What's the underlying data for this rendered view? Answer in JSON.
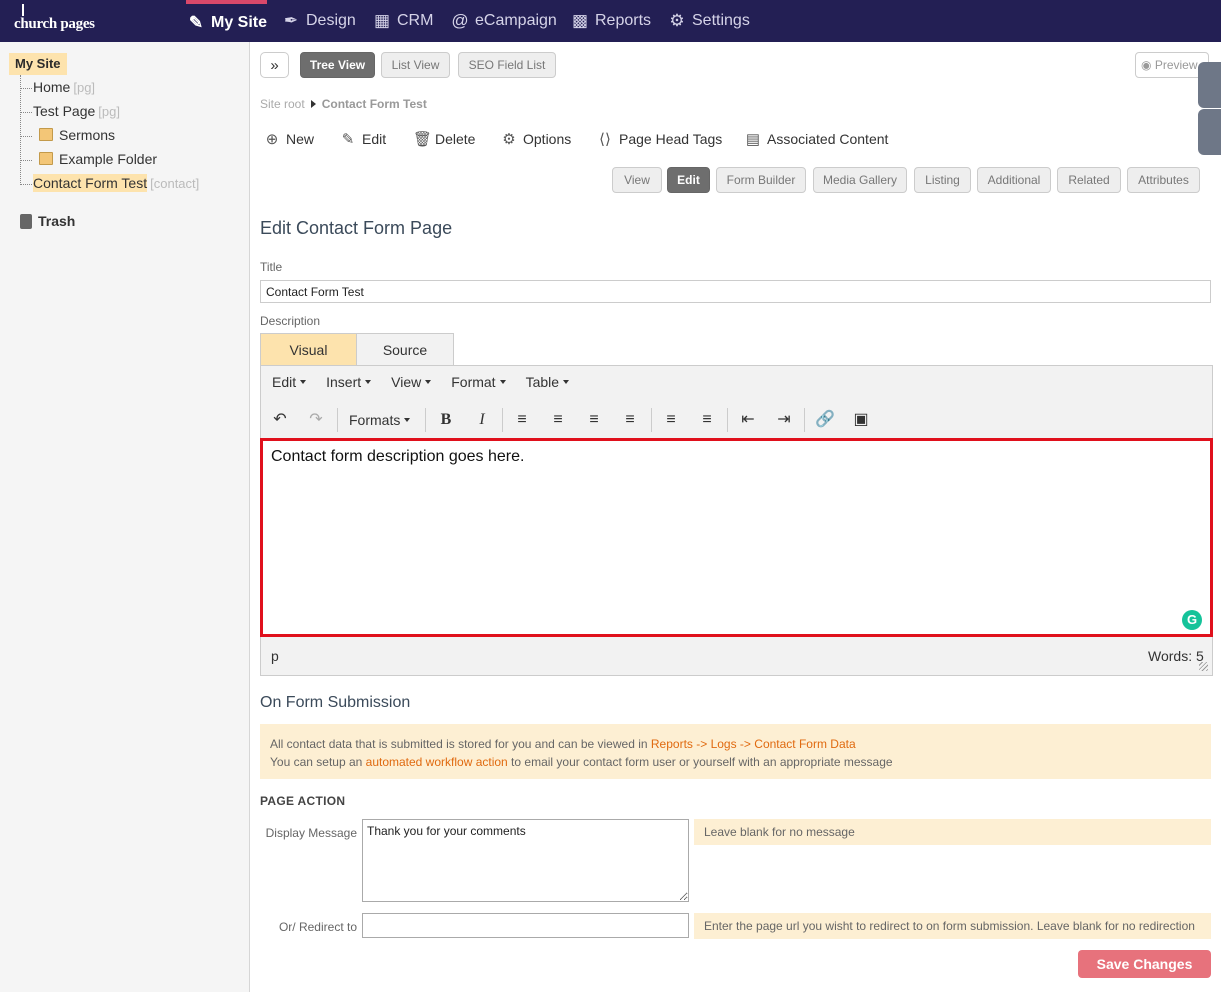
{
  "brand": {
    "logo_text": "church pages"
  },
  "nav": {
    "my_site": "My Site",
    "design": "Design",
    "crm": "CRM",
    "ecampaign": "eCampaign",
    "reports": "Reports",
    "settings": "Settings"
  },
  "sidebar": {
    "root": "My Site",
    "items": [
      {
        "label": "Home",
        "tag": "[pg]"
      },
      {
        "label": "Test Page",
        "tag": "[pg]"
      },
      {
        "label": "Sermons",
        "tag": ""
      },
      {
        "label": "Example Folder",
        "tag": ""
      },
      {
        "label": "Contact Form Test",
        "tag": "[contact]"
      }
    ],
    "trash": "Trash"
  },
  "toolbar": {
    "expand_icon": "»",
    "tree_view": "Tree View",
    "list_view": "List View",
    "seo_field_list": "SEO Field List",
    "preview": "Preview"
  },
  "breadcrumb": {
    "root": "Site root",
    "current": "Contact Form Test"
  },
  "actions": {
    "new": "New",
    "edit": "Edit",
    "delete": "Delete",
    "options": "Options",
    "page_head_tags": "Page Head Tags",
    "associated_content": "Associated Content"
  },
  "page_tabs": [
    "View",
    "Edit",
    "Form Builder",
    "Media Gallery",
    "Listing",
    "Additional",
    "Related",
    "Attributes"
  ],
  "form": {
    "heading": "Edit Contact Form Page",
    "title_label": "Title",
    "title_value": "Contact Form Test",
    "description_label": "Description"
  },
  "editor": {
    "tab_visual": "Visual",
    "tab_source": "Source",
    "menus": [
      "Edit",
      "Insert",
      "View",
      "Format",
      "Table"
    ],
    "formats_label": "Formats",
    "content": "Contact form description goes here.",
    "status_path": "p",
    "word_count": "Words: 5",
    "grammarly": "G"
  },
  "submission": {
    "heading": "On Form Submission",
    "line1_text": "All contact data that is submitted is stored for you and can be viewed in ",
    "line1_link": "Reports -> Logs -> Contact Form Data",
    "line2_prefix": "You can setup an ",
    "line2_link": "automated workflow action",
    "line2_suffix": " to email your contact form user or yourself with an appropriate message"
  },
  "page_action": {
    "heading": "PAGE ACTION",
    "display_message_label": "Display Message",
    "display_message_value": "Thank you for your comments",
    "display_message_hint": "Leave blank for no message",
    "redirect_label": "Or/ Redirect to",
    "redirect_value": "",
    "redirect_hint": "Enter the page url you wisht to redirect to on form submission. Leave blank for no redirection",
    "save_button": "Save Changes"
  },
  "colors": {
    "nav_bg": "#231f54",
    "active_accent": "#d9486a",
    "highlight": "#fde3ad",
    "notice_bg": "#fdefd3",
    "link": "#e06a10",
    "editor_border": "#e0101c",
    "save_button": "#e7727c"
  }
}
